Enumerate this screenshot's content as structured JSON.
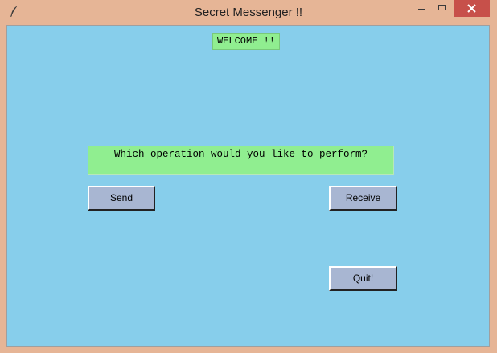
{
  "window": {
    "title": "Secret Messenger !!",
    "icon": "feather-icon",
    "controls": [
      "minimize-icon",
      "maximize-icon",
      "close-icon"
    ],
    "colors": {
      "frame": "#e6b596",
      "close": "#c7504a",
      "background": "#87ceeb"
    }
  },
  "main": {
    "welcome_label": "WELCOME !!",
    "question_label": "Which operation would you like to perform?",
    "label_color": "#90ee90",
    "button_color": "#a8b6d2",
    "send_button": "Send",
    "receive_button": "Receive",
    "quit_button": "Quit!"
  }
}
